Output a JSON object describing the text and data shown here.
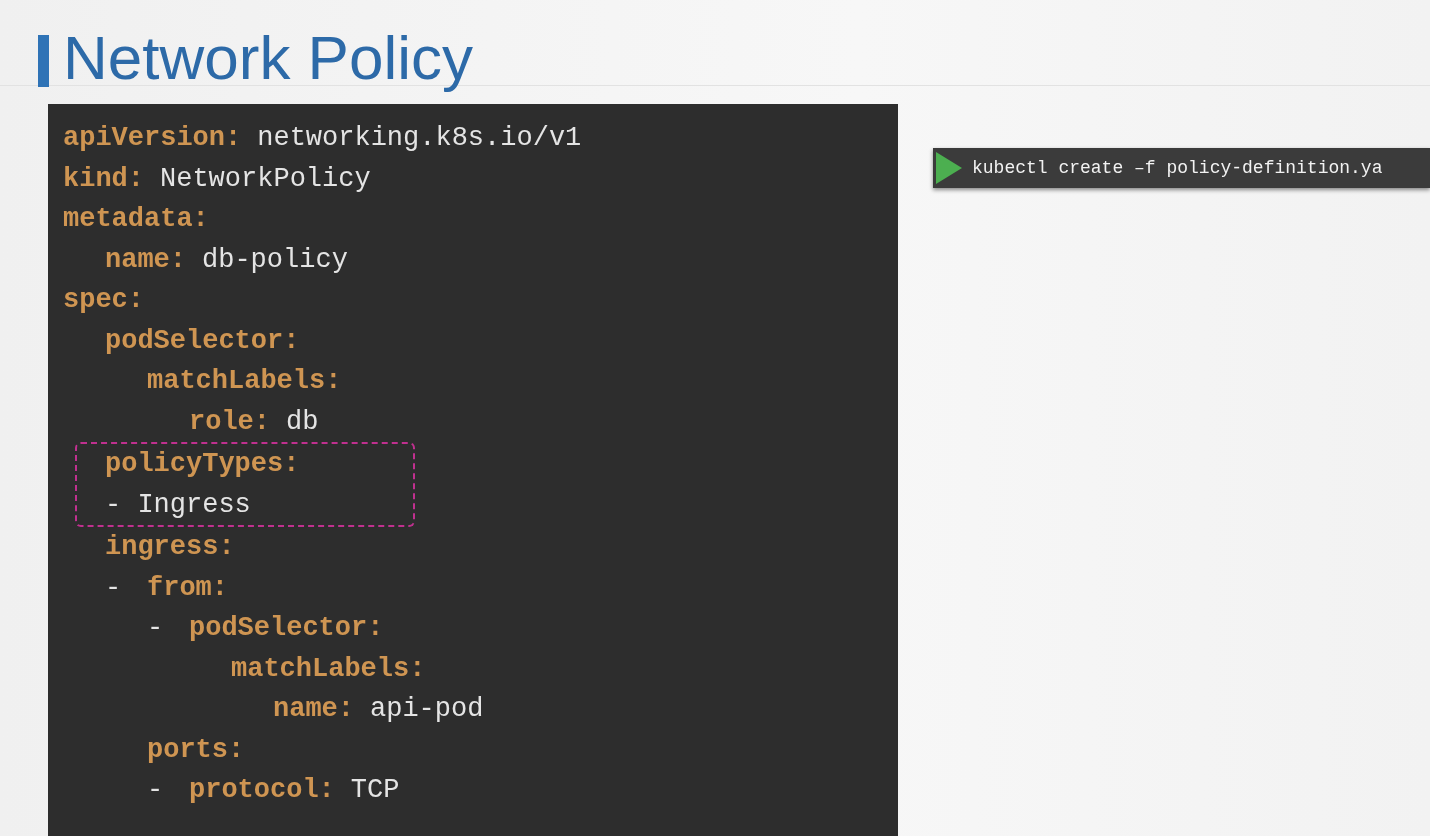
{
  "slide": {
    "title": "Network Policy"
  },
  "code": [
    {
      "kind": "entry",
      "key": "apiVersion:",
      "value": "networking.k8s.io/v1"
    },
    {
      "kind": "entry",
      "key": "kind:",
      "value": "NetworkPolicy"
    },
    {
      "kind": "entry",
      "key": "metadata:",
      "children": [
        {
          "kind": "entry",
          "key": "name:",
          "value": "db-policy"
        }
      ]
    },
    {
      "kind": "entry",
      "key": "spec:",
      "children": [
        {
          "kind": "entry",
          "key": "podSelector:",
          "highlighted": false,
          "children": [
            {
              "kind": "entry",
              "key": "matchLabels:",
              "children": [
                {
                  "kind": "entry",
                  "key": "role:",
                  "value": "db"
                }
              ]
            }
          ]
        },
        {
          "kind": "entry",
          "key": "policyTypes:",
          "highlighted": true,
          "children": [
            {
              "kind": "item",
              "dash": "-",
              "value": "Ingress"
            }
          ]
        },
        {
          "kind": "entry",
          "key": "ingress:",
          "highlighted": false,
          "children": [
            {
              "kind": "item",
              "dash": "-",
              "entries": [
                {
                  "kind": "entry",
                  "key": "from:",
                  "children": [
                    {
                      "kind": "item",
                      "dash": "-",
                      "entries": [
                        {
                          "kind": "entry",
                          "key": "podSelector:",
                          "children": [
                            {
                              "kind": "entry",
                              "key": "matchLabels:",
                              "children": [
                                {
                                  "kind": "entry",
                                  "key": "name:",
                                  "value": "api-pod"
                                }
                              ]
                            }
                          ]
                        }
                      ]
                    }
                  ]
                },
                {
                  "kind": "entry",
                  "key": "ports:",
                  "children": [
                    {
                      "kind": "item",
                      "dash": "-",
                      "entries": [
                        {
                          "kind": "entry",
                          "key": "protocol:",
                          "value": "TCP"
                        }
                      ]
                    }
                  ]
                }
              ]
            }
          ]
        }
      ]
    }
  ],
  "terminal": {
    "command": "kubectl create –f policy-definition.ya"
  }
}
